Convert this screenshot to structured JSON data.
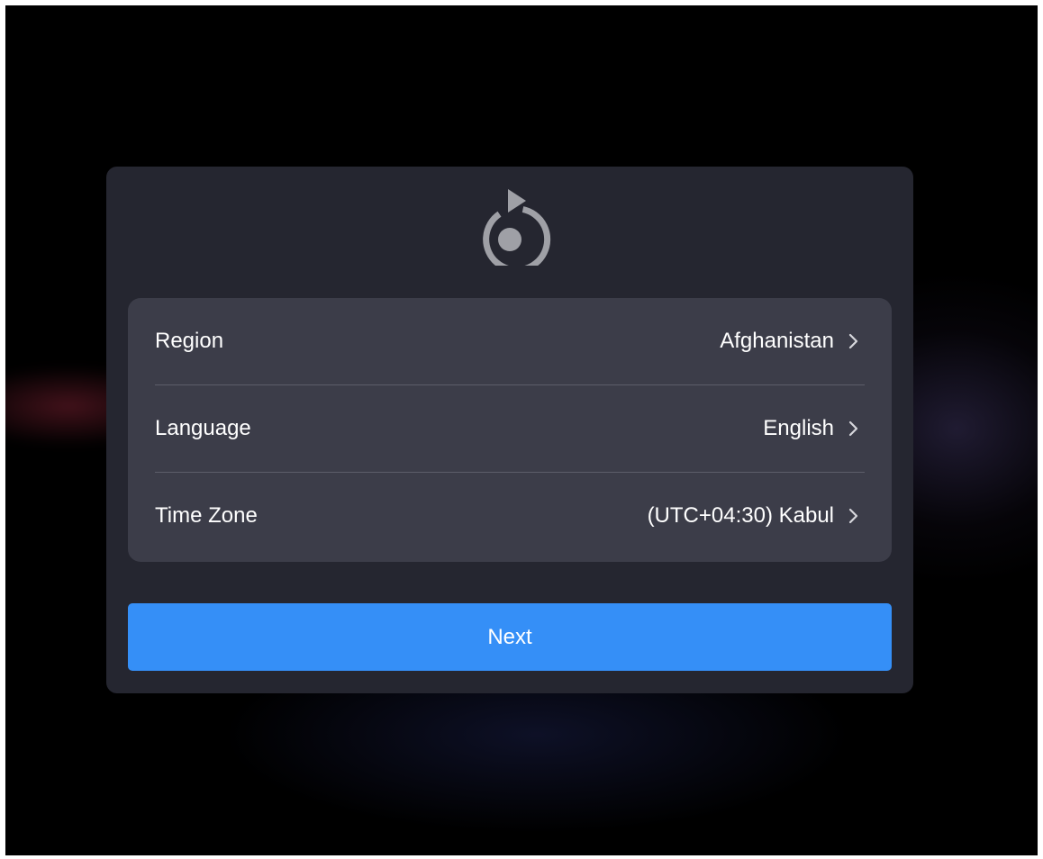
{
  "logo": {
    "icon": "reset-setup-icon",
    "color": "#9fa0a6"
  },
  "settings": {
    "rows": [
      {
        "label": "Region",
        "value": "Afghanistan"
      },
      {
        "label": "Language",
        "value": "English"
      },
      {
        "label": "Time Zone",
        "value": "(UTC+04:30) Kabul"
      }
    ]
  },
  "next_button": {
    "label": "Next",
    "color": "#358ff7"
  },
  "colors": {
    "background": "#000000",
    "dialog": "#252630",
    "card": "#3c3d49",
    "text": "#ffffff"
  }
}
